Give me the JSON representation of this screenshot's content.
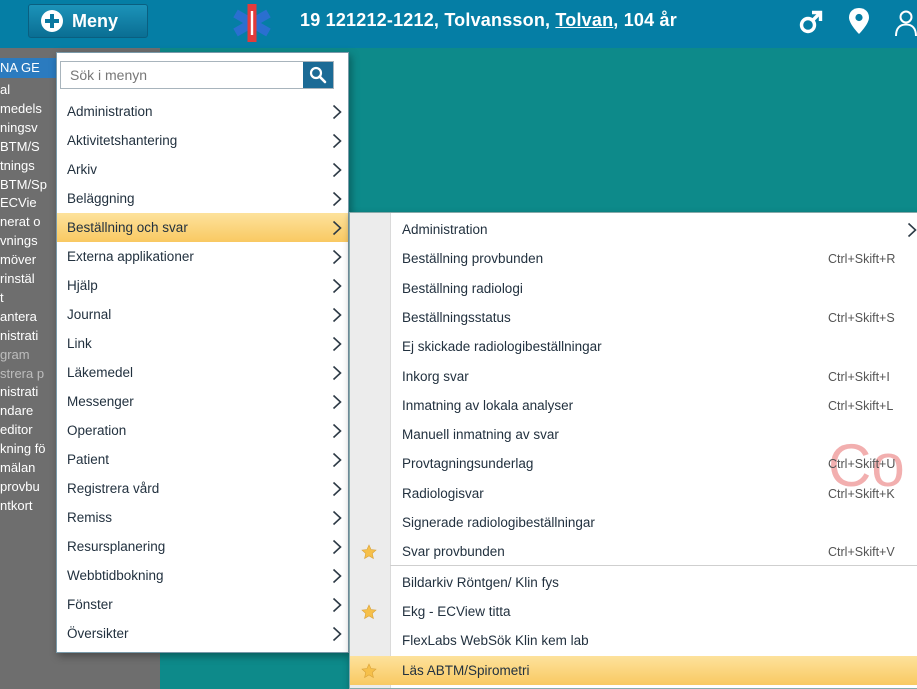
{
  "header": {
    "menu_button_label": "Meny",
    "patient": {
      "id": "19 121212-1212,",
      "surname": "Tolvansson,",
      "nickname": "Tolvan",
      "age": ", 104 år"
    }
  },
  "sidebar": {
    "head_label": "NA GE",
    "items": [
      {
        "label": "al",
        "dim": false
      },
      {
        "label": "medels",
        "dim": false
      },
      {
        "label": "ningsv",
        "dim": false
      },
      {
        "label": "BTM/S",
        "dim": false
      },
      {
        "label": "tnings",
        "dim": false
      },
      {
        "label": "BTM/Sp",
        "dim": false
      },
      {
        "label": "ECVie",
        "dim": false
      },
      {
        "label": "nerat o",
        "dim": false
      },
      {
        "label": "vnings",
        "dim": false
      },
      {
        "label": "möver",
        "dim": false
      },
      {
        "label": "rinstäl",
        "dim": false
      },
      {
        "label": "t",
        "dim": false
      },
      {
        "label": "antera",
        "dim": false
      },
      {
        "label": "nistrati",
        "dim": false
      },
      {
        "label": "gram",
        "dim": true
      },
      {
        "label": "strera p",
        "dim": true
      },
      {
        "label": "nistrati",
        "dim": false
      },
      {
        "label": "ndare",
        "dim": false
      },
      {
        "label": "editor",
        "dim": false
      },
      {
        "label": "kning fö",
        "dim": false
      },
      {
        "label": "mälan",
        "dim": false
      },
      {
        "label": "provbu",
        "dim": false
      },
      {
        "label": "ntkort",
        "dim": false
      }
    ]
  },
  "menu": {
    "search_placeholder": "Sök i menyn",
    "items": [
      {
        "label": "Administration",
        "active": false
      },
      {
        "label": "Aktivitetshantering",
        "active": false
      },
      {
        "label": "Arkiv",
        "active": false
      },
      {
        "label": "Beläggning",
        "active": false
      },
      {
        "label": "Beställning och svar",
        "active": true
      },
      {
        "label": "Externa applikationer",
        "active": false
      },
      {
        "label": "Hjälp",
        "active": false
      },
      {
        "label": "Journal",
        "active": false
      },
      {
        "label": "Link",
        "active": false
      },
      {
        "label": "Läkemedel",
        "active": false
      },
      {
        "label": "Messenger",
        "active": false
      },
      {
        "label": "Operation",
        "active": false
      },
      {
        "label": "Patient",
        "active": false
      },
      {
        "label": "Registrera vård",
        "active": false
      },
      {
        "label": "Remiss",
        "active": false
      },
      {
        "label": "Resursplanering",
        "active": false
      },
      {
        "label": "Webbtidbokning",
        "active": false
      },
      {
        "label": "Fönster",
        "active": false
      },
      {
        "label": "Översikter",
        "active": false
      }
    ]
  },
  "submenu": {
    "watermark_text": "Co",
    "items": [
      {
        "label": "Administration",
        "shortcut": "",
        "has_arrow": true,
        "starred": false,
        "active": false
      },
      {
        "label": "Beställning provbunden",
        "shortcut": "Ctrl+Skift+R",
        "has_arrow": false,
        "starred": false,
        "active": false
      },
      {
        "label": "Beställning radiologi",
        "shortcut": "",
        "has_arrow": false,
        "starred": false,
        "active": false
      },
      {
        "label": "Beställningsstatus",
        "shortcut": "Ctrl+Skift+S",
        "has_arrow": false,
        "starred": false,
        "active": false
      },
      {
        "label": "Ej skickade radiologibeställningar",
        "shortcut": "",
        "has_arrow": false,
        "starred": false,
        "active": false
      },
      {
        "label": "Inkorg svar",
        "shortcut": "Ctrl+Skift+I",
        "has_arrow": false,
        "starred": false,
        "active": false
      },
      {
        "label": "Inmatning av lokala analyser",
        "shortcut": "Ctrl+Skift+L",
        "has_arrow": false,
        "starred": false,
        "active": false
      },
      {
        "label": "Manuell inmatning av svar",
        "shortcut": "",
        "has_arrow": false,
        "starred": false,
        "active": false
      },
      {
        "label": "Provtagningsunderlag",
        "shortcut": "Ctrl+Skift+U",
        "has_arrow": false,
        "starred": false,
        "active": false
      },
      {
        "label": "Radiologisvar",
        "shortcut": "Ctrl+Skift+K",
        "has_arrow": false,
        "starred": false,
        "active": false
      },
      {
        "label": "Signerade radiologibeställningar",
        "shortcut": "",
        "has_arrow": false,
        "starred": false,
        "active": false
      },
      {
        "label": "Svar provbunden",
        "shortcut": "Ctrl+Skift+V",
        "has_arrow": false,
        "starred": true,
        "active": false
      },
      {
        "label": "Bildarkiv Röntgen/ Klin fys",
        "shortcut": "",
        "has_arrow": false,
        "starred": false,
        "active": false
      },
      {
        "label": "Ekg - ECView titta",
        "shortcut": "",
        "has_arrow": false,
        "starred": true,
        "active": false
      },
      {
        "label": "FlexLabs WebSök Klin kem lab",
        "shortcut": "",
        "has_arrow": false,
        "starred": false,
        "active": false
      },
      {
        "label": "Läs ABTM/Spirometri",
        "shortcut": "",
        "has_arrow": false,
        "starred": true,
        "active": true
      }
    ]
  },
  "colors": {
    "topbar": "#057ea5",
    "background": "#0d8a8a",
    "highlight": "#f9c962",
    "star": "#f6c04a",
    "sidebar": "#6e6e6e"
  }
}
